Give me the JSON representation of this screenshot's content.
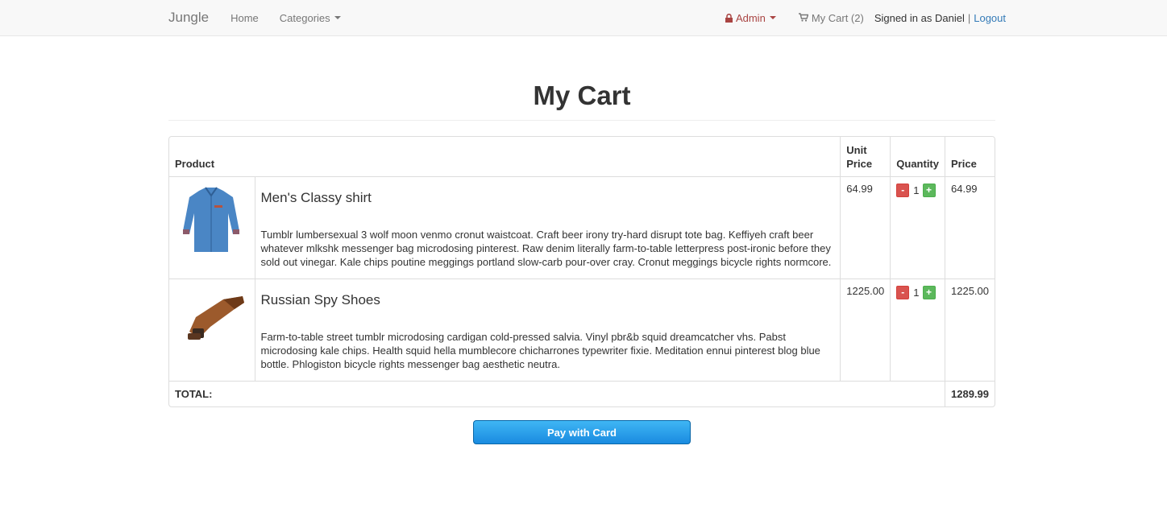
{
  "navbar": {
    "brand": "Jungle",
    "home": "Home",
    "categories": "Categories",
    "admin": "Admin",
    "cart": "My Cart (2)",
    "signed_in": "Signed in as Daniel",
    "separator": "|",
    "logout": "Logout"
  },
  "page": {
    "title": "My Cart"
  },
  "table": {
    "headers": {
      "product": "Product",
      "unit_price": "Unit Price",
      "quantity": "Quantity",
      "price": "Price"
    },
    "items": [
      {
        "name": "Men's Classy shirt",
        "description": "Tumblr lumbersexual 3 wolf moon venmo cronut waistcoat. Craft beer irony try-hard disrupt tote bag. Keffiyeh craft beer whatever mlkshk messenger bag microdosing pinterest. Raw denim literally farm-to-table letterpress post-ironic before they sold out vinegar. Kale chips poutine meggings portland slow-carb pour-over cray. Cronut meggings bicycle rights normcore.",
        "unit_price": "64.99",
        "quantity": "1",
        "price": "64.99"
      },
      {
        "name": "Russian Spy Shoes",
        "description": "Farm-to-table street tumblr microdosing cardigan cold-pressed salvia. Vinyl pbr&b squid dreamcatcher vhs. Pabst microdosing kale chips. Health squid hella mumblecore chicharrones typewriter fixie. Meditation ennui pinterest blog blue bottle. Phlogiston bicycle rights messenger bag aesthetic neutra.",
        "unit_price": "1225.00",
        "quantity": "1",
        "price": "1225.00"
      }
    ],
    "minus_label": "-",
    "plus_label": "+",
    "total_label": "TOTAL:",
    "total_value": "1289.99"
  },
  "pay_button": "Pay with Card",
  "colors": {
    "admin": "#a94442",
    "link": "#337ab7",
    "minus": "#d9534f",
    "plus": "#5cb85c",
    "pay": "#1a8be0"
  }
}
